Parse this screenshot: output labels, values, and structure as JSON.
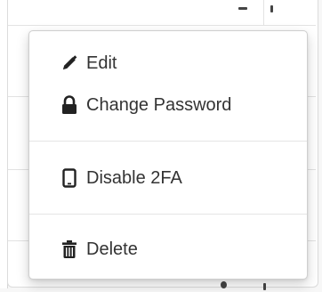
{
  "menu": {
    "items": [
      {
        "label": "Edit",
        "icon": "pencil-icon"
      },
      {
        "label": "Change Password",
        "icon": "lock-icon"
      },
      {
        "label": "Disable 2FA",
        "icon": "mobile-phone-icon"
      },
      {
        "label": "Delete",
        "icon": "trash-icon"
      }
    ]
  },
  "colors": {
    "text": "#333333",
    "icon": "#222222",
    "divider": "#e5e5e5",
    "border": "#cfcfcf"
  }
}
